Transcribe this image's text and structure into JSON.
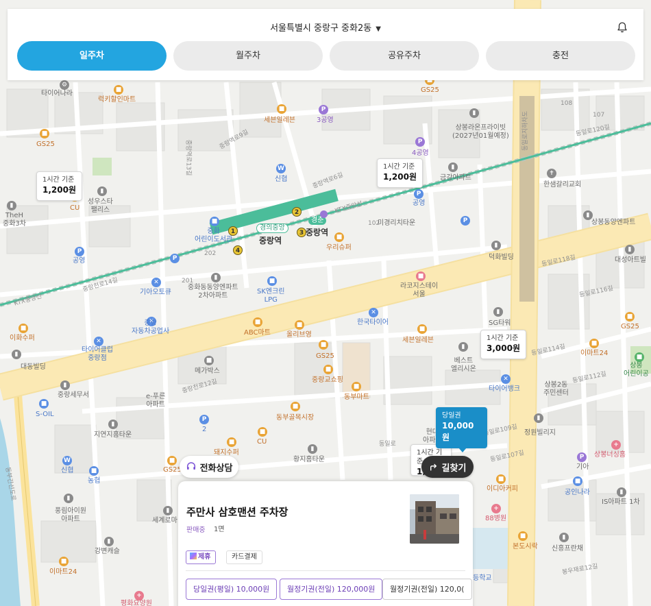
{
  "header": {
    "location": "서울특별시 중랑구 중화2동",
    "tabs": [
      {
        "label": "일주차",
        "active": true
      },
      {
        "label": "월주차",
        "active": false
      },
      {
        "label": "공유주차",
        "active": false
      },
      {
        "label": "충전",
        "active": false
      }
    ]
  },
  "map": {
    "price_tags": [
      {
        "title": "1시간 기준",
        "price": "1,200원"
      },
      {
        "title": "1시간 기준",
        "price": "1,200원"
      },
      {
        "title": "1시간 기준",
        "price": "3,000원"
      },
      {
        "title": "당일권",
        "price": "10,000원"
      },
      {
        "title": "1시간 기준",
        "price": "1,"
      }
    ],
    "labels": {
      "tire_nara": "타이어나라",
      "lucky_mart": "럭키할인마트",
      "gs25_a": "GS25",
      "seven_a": "세븐일레븐",
      "samyeong": "3공영",
      "sangbong_prime": "상봉라온프라이빗\n(2027년01월예정)",
      "gs25_b": "GS25",
      "sinhyeop": "신협",
      "gs25_c": "GS25",
      "seongwoo": "성우스타\n팰리스",
      "cu_a": "CU",
      "theh": "TheH\n중화3차",
      "gongyeong_a": "공영",
      "junghwa_door": "중화\n어린이도서관",
      "jungnang_st": "중랑역",
      "jungnang_st2": "중랑역",
      "gyeongchun": "경춘",
      "gyeongui": "경의중앙",
      "woori": "우리슈퍼",
      "migyeong": "미경리치타운",
      "gongyeong_b": "공영",
      "geumgang": "금강아파트",
      "sagong": "4공영",
      "hansung": "한샘갈리교회",
      "sangbong_apt": "상봉동양엔파트",
      "deokhwa": "덕화빌딩",
      "daesung": "대성아트빌",
      "raco": "라코지스테이\n서울",
      "junghwa_dy": "중화동동양엔파트\n2차아파트",
      "kiya": "기아오토큐",
      "sk": "SK엔크린\nLPG",
      "junghwa_car": "중랑\n자동차공업사",
      "ihwa": "이화수퍼",
      "tire_club": "타이어클럽\n중랑점",
      "abc": "ABC마트",
      "olive": "올리브영",
      "hankook": "한국타이어",
      "seven_b": "세븐일레븐",
      "sg": "SG타워",
      "gs25_d": "GS25",
      "emart24_a": "이마트24",
      "sangbong_kinder": "상봉\n어린이공",
      "daedong": "대동빌딩",
      "megabox": "메가박스",
      "gs25_e": "GS25",
      "jungnang_shop": "중랑교쇼핑",
      "dongbu_mart": "동부마트",
      "best": "베스트\n엘리시온",
      "tire_bank": "타이어뱅크",
      "sangbong2": "상봉2동\n주민센터",
      "jungnang_tax": "중랑세무서",
      "epureun": "e-푸른\n아파트",
      "soil": "S-OIL",
      "jiyeonji": "지연지홈타운",
      "dongbu_gol": "동부골목시장",
      "cu_b": "CU",
      "hyundai": "현대\n아파트",
      "jeongwon": "정원빌리지",
      "sangbong_sim": "상봉너싱홈",
      "gia": "기아",
      "gongin": "공인나라",
      "is_apt": "IS아파트 1차",
      "dwaeji": "돼지수퍼",
      "hwangji": "황지홈타운",
      "sinhyeop2": "신협",
      "nonghyup": "농협",
      "gs25_f": "GS25",
      "pungrim": "풍림아이원\n아파트",
      "segye": "세계로마",
      "gangbyeon": "강변캐슬",
      "emart24_b": "이마트24",
      "emart24_c": "이디아커피",
      "hos88": "88병원",
      "bonddo": "본도시락",
      "sinheung": "신흥프란채",
      "pyeonhwa": "평화요양원",
      "gyo": "등학교",
      "ktx_a": "KTX중앙선",
      "ktx_b": "KTX중앙선",
      "rd_jungnangyeok9": "중랑역로9길",
      "rd_jungnangyeok13": "중랑역로13길",
      "rd_jungnangyeok6": "중랑역로6길",
      "rd_jungnangcheon14": "중랑천로14길",
      "rd_jungnangcheon12": "중랑천로12길",
      "rd_dongil118": "동일로118길",
      "rd_dongil120": "동일로120길",
      "rd_dongil116": "동일로116길",
      "rd_dongil114": "동일로114길",
      "rd_dongil112": "동일로112길",
      "rd_dongil109": "동일로109길",
      "rd_dongil107": "동일로107길",
      "rd_dongil": "동일로",
      "rd_dongbu": "동부간선도로",
      "rd_dongil_vert": "동일로지하차도",
      "rd_bongu": "봉우재로12길",
      "num_108": "108",
      "num_107": "107",
      "num_202": "202",
      "num_201": "201",
      "num_102": "102"
    },
    "station_numbers": [
      "1",
      "2",
      "3",
      "4"
    ]
  },
  "actions": {
    "phone": "전화상담",
    "route": "길찾기"
  },
  "card": {
    "title": "주만사 삼호맨션 주차장",
    "status": "판매중",
    "spaces": "1면",
    "tags": {
      "partner": "제휴",
      "card": "카드결제"
    },
    "tickets": [
      "당일권(평일) 10,000원",
      "월정기권(전일) 120,000원",
      "월정기권(전일) 120,0("
    ]
  },
  "colors": {
    "accent": "#23a5e0",
    "selected_tag": "#1a8ec8",
    "partner": "#9a77d6",
    "road_main": "#fbe39b",
    "railway": "#4bbd9a",
    "river": "#a9d6e8",
    "park": "#c9e3b7"
  },
  "icons": {
    "location_caret": "caret-down-icon",
    "bell": "bell-icon",
    "phone": "headset-icon",
    "route": "turn-right-arrow-icon"
  }
}
